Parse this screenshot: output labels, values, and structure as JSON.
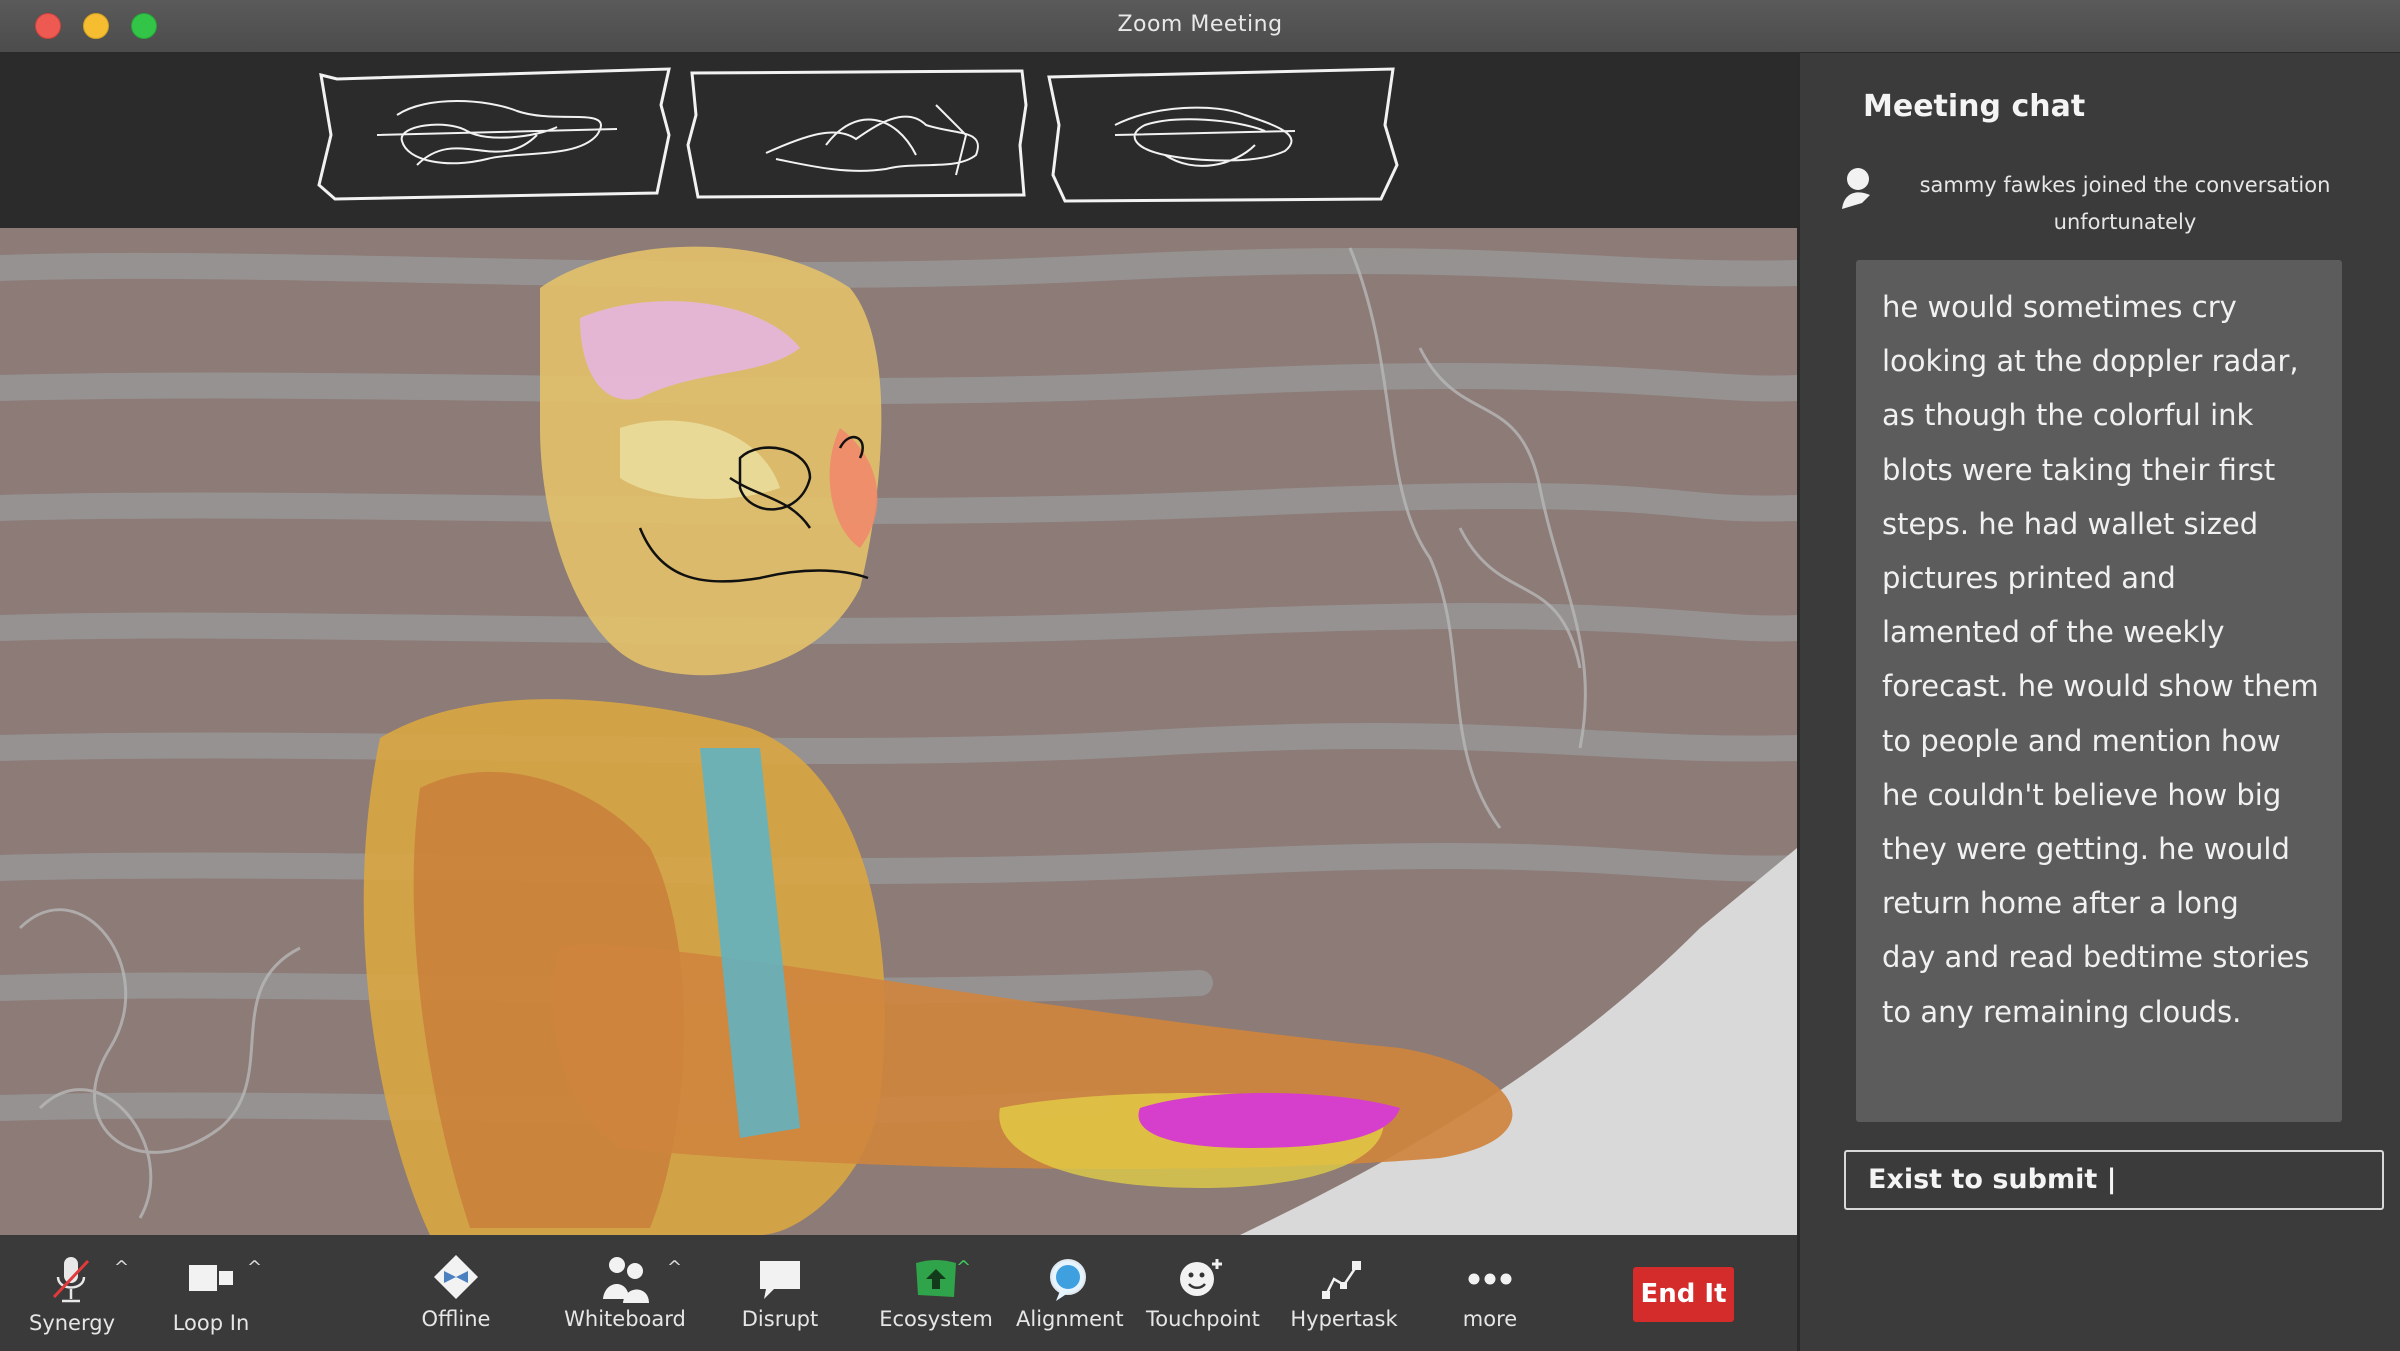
{
  "window": {
    "title": "Zoom Meeting"
  },
  "chat": {
    "title": "Meeting chat",
    "joined_line1": "sammy fawkes  joined the conversation",
    "joined_line2": "unfortunately",
    "message": "he would sometimes cry\nlooking at the doppler radar,\nas though the colorful ink\nblots were taking their first\nsteps. he had wallet sized\npictures printed and\nlamented of the weekly\nforecast. he would show them\nto people and mention how\nhe couldn't believe how big\nthey were getting. he would\nreturn home after a long\nday and read bedtime stories\nto any remaining clouds.",
    "input_value": "Exist to submit |"
  },
  "toolbar": {
    "items": [
      {
        "label": "Synergy",
        "icon": "microphone-muted-icon"
      },
      {
        "label": "Loop In",
        "icon": "video-camera-icon"
      },
      {
        "label": "Offline",
        "icon": "bowtie-icon"
      },
      {
        "label": "Whiteboard",
        "icon": "participants-icon"
      },
      {
        "label": "Disrupt",
        "icon": "chat-bubble-icon"
      },
      {
        "label": "Ecosystem",
        "icon": "share-screen-icon"
      },
      {
        "label": "Alignment",
        "icon": "bubble-icon"
      },
      {
        "label": "Touchpoint",
        "icon": "reaction-icon"
      },
      {
        "label": "Hypertask",
        "icon": "apps-icon"
      },
      {
        "label": "more",
        "icon": "more-dots-icon"
      }
    ],
    "end_label": "End It"
  },
  "colors": {
    "end_button": "#d42b2b",
    "share_green": "#2fa44a",
    "wall": "#8c7b76"
  }
}
